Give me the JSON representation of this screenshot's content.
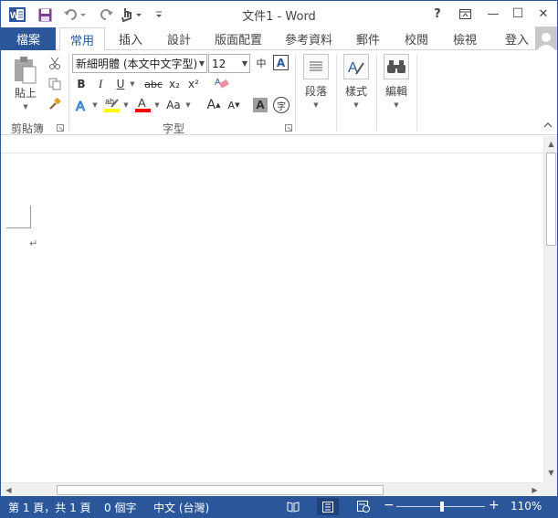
{
  "window": {
    "title": "文件1 - Word",
    "controls": {
      "help": "?",
      "minimize": "—",
      "maximize": "☐",
      "close": "✕"
    }
  },
  "quick_access": [
    {
      "name": "word-logo-icon"
    },
    {
      "name": "save-icon"
    },
    {
      "name": "undo-icon"
    },
    {
      "name": "redo-icon"
    },
    {
      "name": "touch-mode-icon"
    },
    {
      "name": "customize-qat-icon"
    }
  ],
  "tabs": {
    "file": "檔案",
    "items": [
      "常用",
      "插入",
      "設計",
      "版面配置",
      "參考資料",
      "郵件",
      "校閱",
      "檢視"
    ],
    "active": "常用",
    "signin": "登入"
  },
  "ribbon": {
    "clipboard": {
      "label": "剪貼簿",
      "paste": "貼上"
    },
    "font": {
      "label": "字型",
      "font_name": "新細明體 (本文中文字型)",
      "font_size": "12",
      "bold": "B",
      "italic": "I",
      "underline": "U",
      "strike": "abc",
      "subscript": "x₂",
      "superscript": "x²",
      "change_case": "Aa",
      "grow": "A",
      "shrink": "A",
      "char_shading": "A",
      "enclose": "字",
      "phonetic": "中",
      "border": "A"
    },
    "paragraph": {
      "label": "段落"
    },
    "styles": {
      "label": "樣式"
    },
    "editing": {
      "label": "編輯"
    }
  },
  "document": {
    "paragraph_mark": "↵"
  },
  "statusbar": {
    "page": "第 1 頁，共 1 頁",
    "words": "0 個字",
    "language": "中文 (台灣)",
    "zoom_minus": "−",
    "zoom_plus": "+",
    "zoom": "110%",
    "zoom_level_percent": 110
  },
  "colors": {
    "accent": "#2b579a",
    "highlight": "#ffff00",
    "font_color": "#ff0000"
  }
}
